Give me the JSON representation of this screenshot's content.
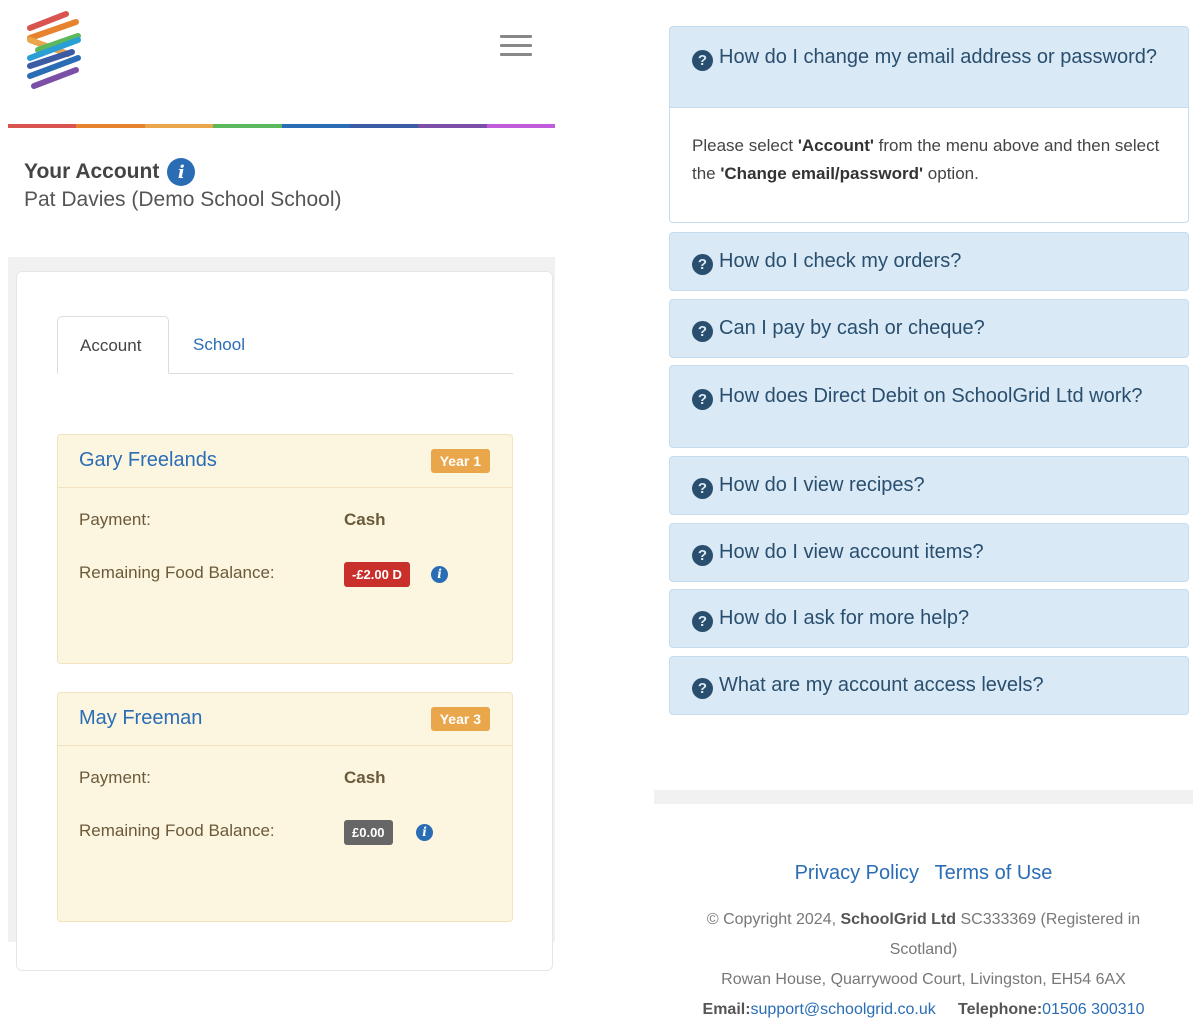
{
  "header": {
    "menu_icon": "hamburger-icon"
  },
  "rainbow_colors": [
    "#d9534f",
    "#e7832f",
    "#eaa64a",
    "#5cb85c",
    "#2a6db5",
    "#3b5ba5",
    "#7b4fa5",
    "#c05cd9"
  ],
  "account": {
    "title": "Your Account",
    "name": "Pat Davies (Demo School School)"
  },
  "tabs": [
    {
      "label": "Account",
      "active": true
    },
    {
      "label": "School",
      "active": false
    }
  ],
  "children": [
    {
      "name": "Gary Freelands",
      "year": "Year 1",
      "payment_label": "Payment:",
      "payment_value": "Cash",
      "balance_label": "Remaining Food Balance:",
      "balance_value": "-£2.00 D",
      "balance_color": "#c9302c"
    },
    {
      "name": "May Freeman",
      "year": "Year 3",
      "payment_label": "Payment:",
      "payment_value": "Cash",
      "balance_label": "Remaining Food Balance:",
      "balance_value": "£0.00",
      "balance_color": "#666666"
    }
  ],
  "faq": {
    "open_question": "How do I change my email address or password?",
    "open_answer": {
      "p1": "Please select ",
      "b1": "'Account'",
      "p2": " from the menu above and then select the ",
      "b2": "'Change email/password'",
      "p3": " option."
    },
    "questions": [
      "How do I check my orders?",
      "Can I pay by cash or cheque?",
      "How does Direct Debit on SchoolGrid Ltd work?",
      "How do I view recipes?",
      "How do I view account items?",
      "How do I ask for more help?",
      "What are my account access levels?"
    ]
  },
  "footer": {
    "privacy": "Privacy Policy",
    "terms": "Terms of Use",
    "copyright_pre": "© Copyright 2024, ",
    "company": "SchoolGrid Ltd",
    "copyright_post": " SC333369 (Registered in Scotland)",
    "address": "Rowan House, Quarrywood Court, Livingston, EH54 6AX",
    "email_label": "Email:",
    "email": "support@schoolgrid.co.uk",
    "phone_label": "Telephone:",
    "phone": "01506 300310"
  }
}
